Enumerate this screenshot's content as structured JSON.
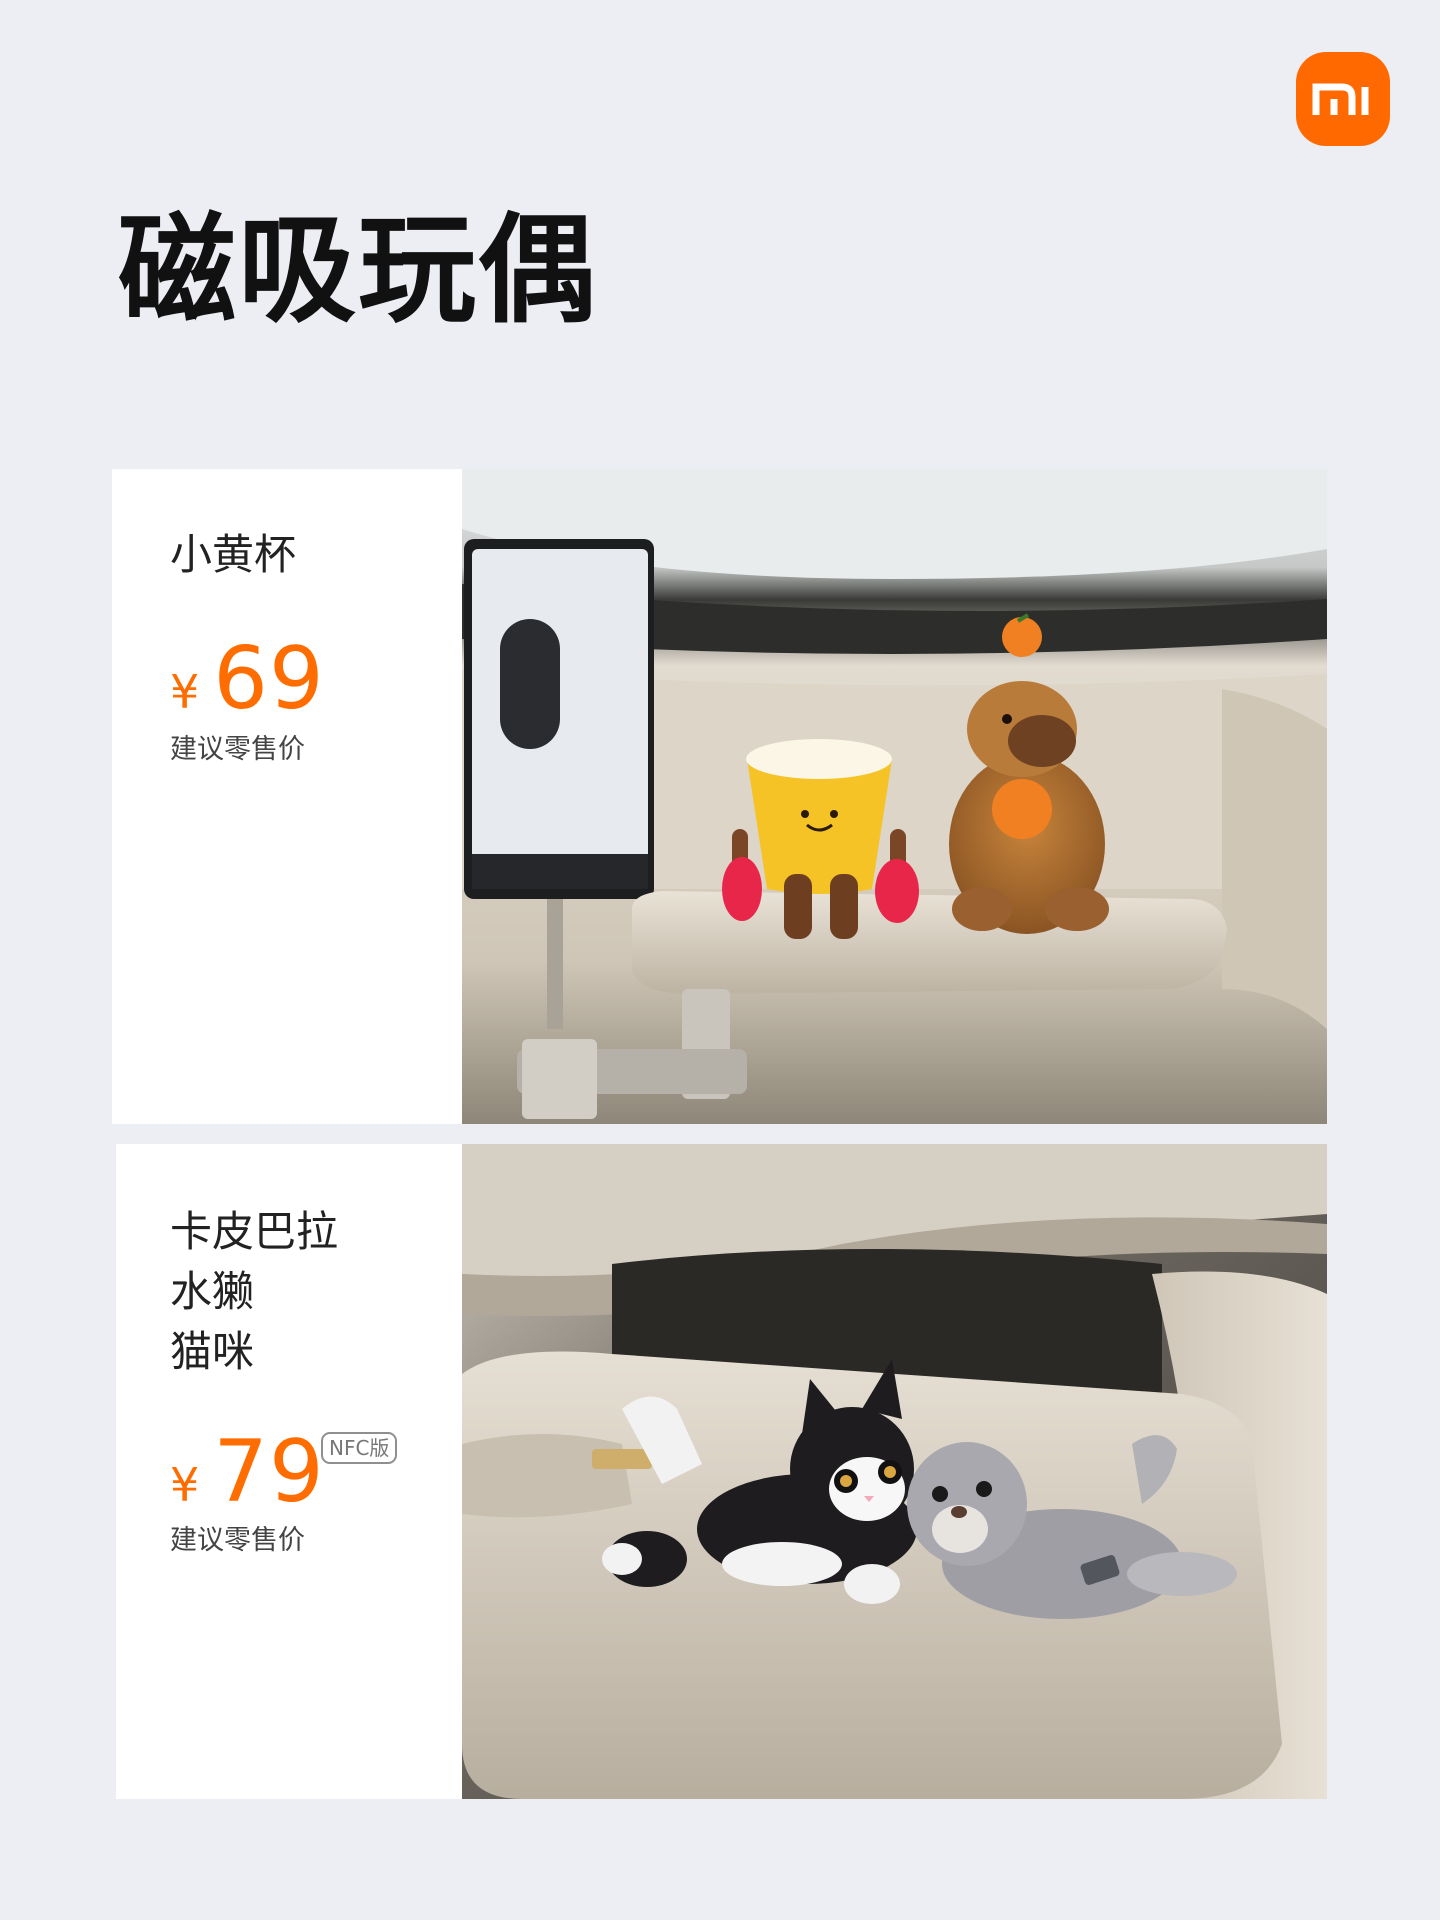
{
  "brand": {
    "logo_text": "mi",
    "accent_color": "#ff6900"
  },
  "page_title": "磁吸玩偶",
  "price_color": "#ff6d00",
  "products": [
    {
      "names": [
        "小黄杯"
      ],
      "currency": "¥",
      "price": "69",
      "badge": "",
      "price_note": "建议零售价",
      "photo": "yellow-cup-and-capybara-plush-on-car-dashboard-tray"
    },
    {
      "names": [
        "卡皮巴拉",
        "水獭",
        "猫咪"
      ],
      "currency": "¥",
      "price": "79",
      "badge": "NFC版",
      "price_note": "建议零售价",
      "photo": "cat-and-otter-plush-on-car-center-console"
    }
  ]
}
